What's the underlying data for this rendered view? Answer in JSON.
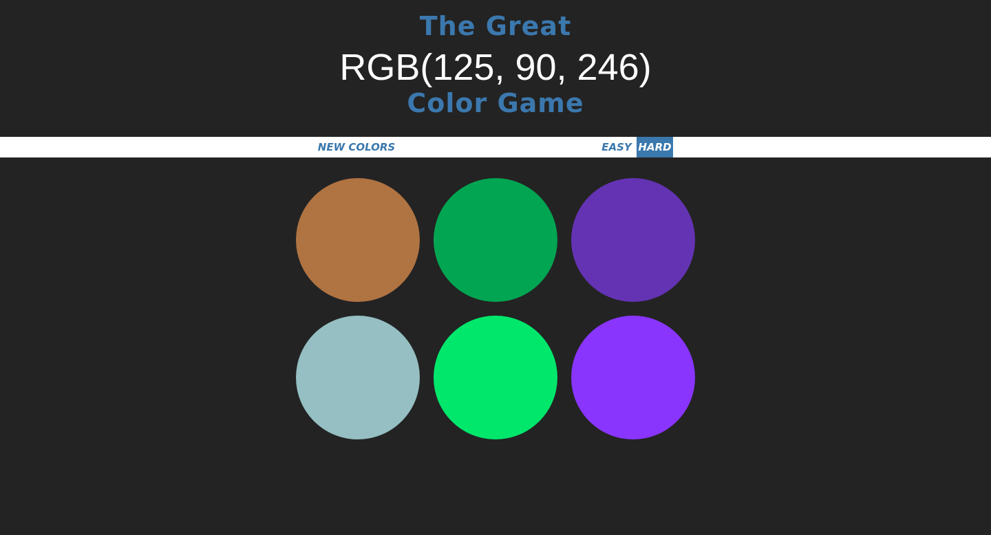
{
  "header": {
    "title_top": "The Great",
    "rgb_display": "RGB(125, 90, 246)",
    "title_bottom": "Color Game",
    "accent_color": "#3b78ad"
  },
  "stripe": {
    "new_colors_label": "New Colors",
    "easy_label": "Easy",
    "hard_label": "Hard",
    "selected_mode": "Hard"
  },
  "squares": [
    {
      "color": "#b07342"
    },
    {
      "color": "#02a552"
    },
    {
      "color": "#6433b3"
    },
    {
      "color": "#95bfc2"
    },
    {
      "color": "#01e76c"
    },
    {
      "color": "#8935fe"
    }
  ]
}
